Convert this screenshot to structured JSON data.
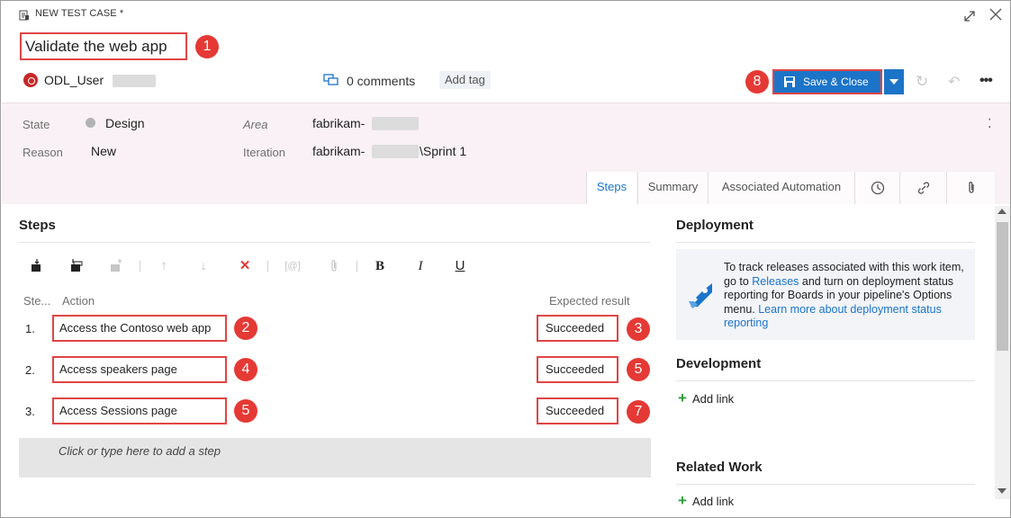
{
  "window": {
    "type_label": "NEW TEST CASE *",
    "title": "Validate the web app"
  },
  "owner": {
    "name": "ODL_User"
  },
  "discussion": {
    "comments": "0 comments",
    "add_tag": "Add tag"
  },
  "toolbar": {
    "save_close_label": "Save & Close"
  },
  "fields": {
    "state_label": "State",
    "state_value": "Design",
    "reason_label": "Reason",
    "reason_value": "New",
    "area_label": "Area",
    "area_value": "fabrikam-",
    "iteration_label": "Iteration",
    "iteration_value_prefix": "fabrikam-",
    "iteration_value_suffix": "\\Sprint 1"
  },
  "tabs": [
    {
      "label": "Steps",
      "active": true
    },
    {
      "label": "Summary",
      "active": false
    },
    {
      "label": "Associated Automation",
      "active": false
    }
  ],
  "steps": {
    "title": "Steps",
    "col_step": "Ste...",
    "col_action": "Action",
    "col_expected": "Expected result",
    "rows": [
      {
        "num": "1.",
        "action": "Access the Contoso web app",
        "expected": "Succeeded"
      },
      {
        "num": "2.",
        "action": "Access speakers page",
        "expected": "Succeeded"
      },
      {
        "num": "3.",
        "action": "Access Sessions page",
        "expected": "Succeeded"
      }
    ],
    "add_step_placeholder": "Click or type here to add a step"
  },
  "callouts": {
    "title": "1",
    "row1_action": "2",
    "row1_result": "3",
    "row2_action": "4",
    "row2_result": "5",
    "row3_action": "5",
    "row3_result": "7",
    "save": "8"
  },
  "deployment": {
    "title": "Deployment",
    "text_1": "To track releases associated with this work item, go to ",
    "link_releases": "Releases",
    "text_2": " and turn on deployment status reporting for Boards in your pipeline's Options menu. ",
    "link_learn": "Learn more about deployment status reporting"
  },
  "development": {
    "title": "Development",
    "add_link": "Add link"
  },
  "related_work": {
    "title": "Related Work",
    "add_link": "Add link"
  },
  "colors": {
    "accent": "#1b74c8",
    "callout": "#e53935",
    "highlight_border": "#e04545",
    "fields_band": "#f9f1f5"
  }
}
